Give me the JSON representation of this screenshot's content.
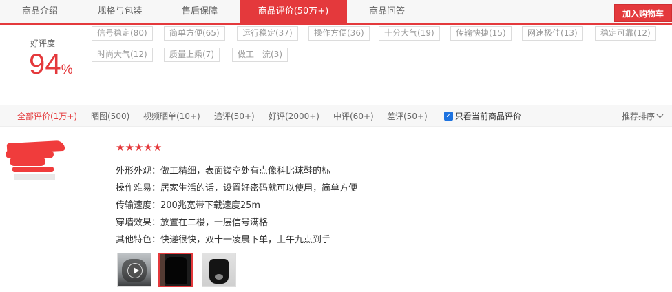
{
  "tabs": [
    {
      "label": "商品介绍"
    },
    {
      "label": "规格与包装"
    },
    {
      "label": "售后保障"
    },
    {
      "label": "商品评价(50万+)"
    },
    {
      "label": "商品问答"
    }
  ],
  "cart_button": "加入购物车",
  "rating": {
    "label": "好评度",
    "value": "94",
    "unit": "%"
  },
  "tags": [
    "信号稳定(80)",
    "简单方便(65)",
    "运行稳定(37)",
    "操作方便(36)",
    "十分大气(19)",
    "传输快捷(15)",
    "网速极佳(13)",
    "稳定可靠(12)",
    "时尚大气(12)",
    "质量上乘(7)",
    "做工一流(3)"
  ],
  "filters": [
    "全部评价(1万+)",
    "晒图(500)",
    "视频晒单(10+)",
    "追评(50+)",
    "好评(2000+)",
    "中评(60+)",
    "差评(50+)"
  ],
  "only_current_label": "只看当前商品评价",
  "sort_label": "推荐排序",
  "review": {
    "stars": 5,
    "lines": [
      "外形外观：做工精细，表面镂空处有点像科比球鞋的标",
      "操作难易：居家生活的话，设置好密码就可以使用，简单方便",
      "传输速度：200兆宽带下载速度25m",
      "穿墙效果：放置在二楼，一层信号满格",
      "其他特色：快递很快，双十一凌晨下单，上午九点到手"
    ]
  },
  "colors": {
    "accent": "#e4393c",
    "checkbox": "#1e73e0"
  },
  "icons": [
    "star-icon",
    "play-icon",
    "checkbox-icon",
    "chevron-down-icon"
  ]
}
